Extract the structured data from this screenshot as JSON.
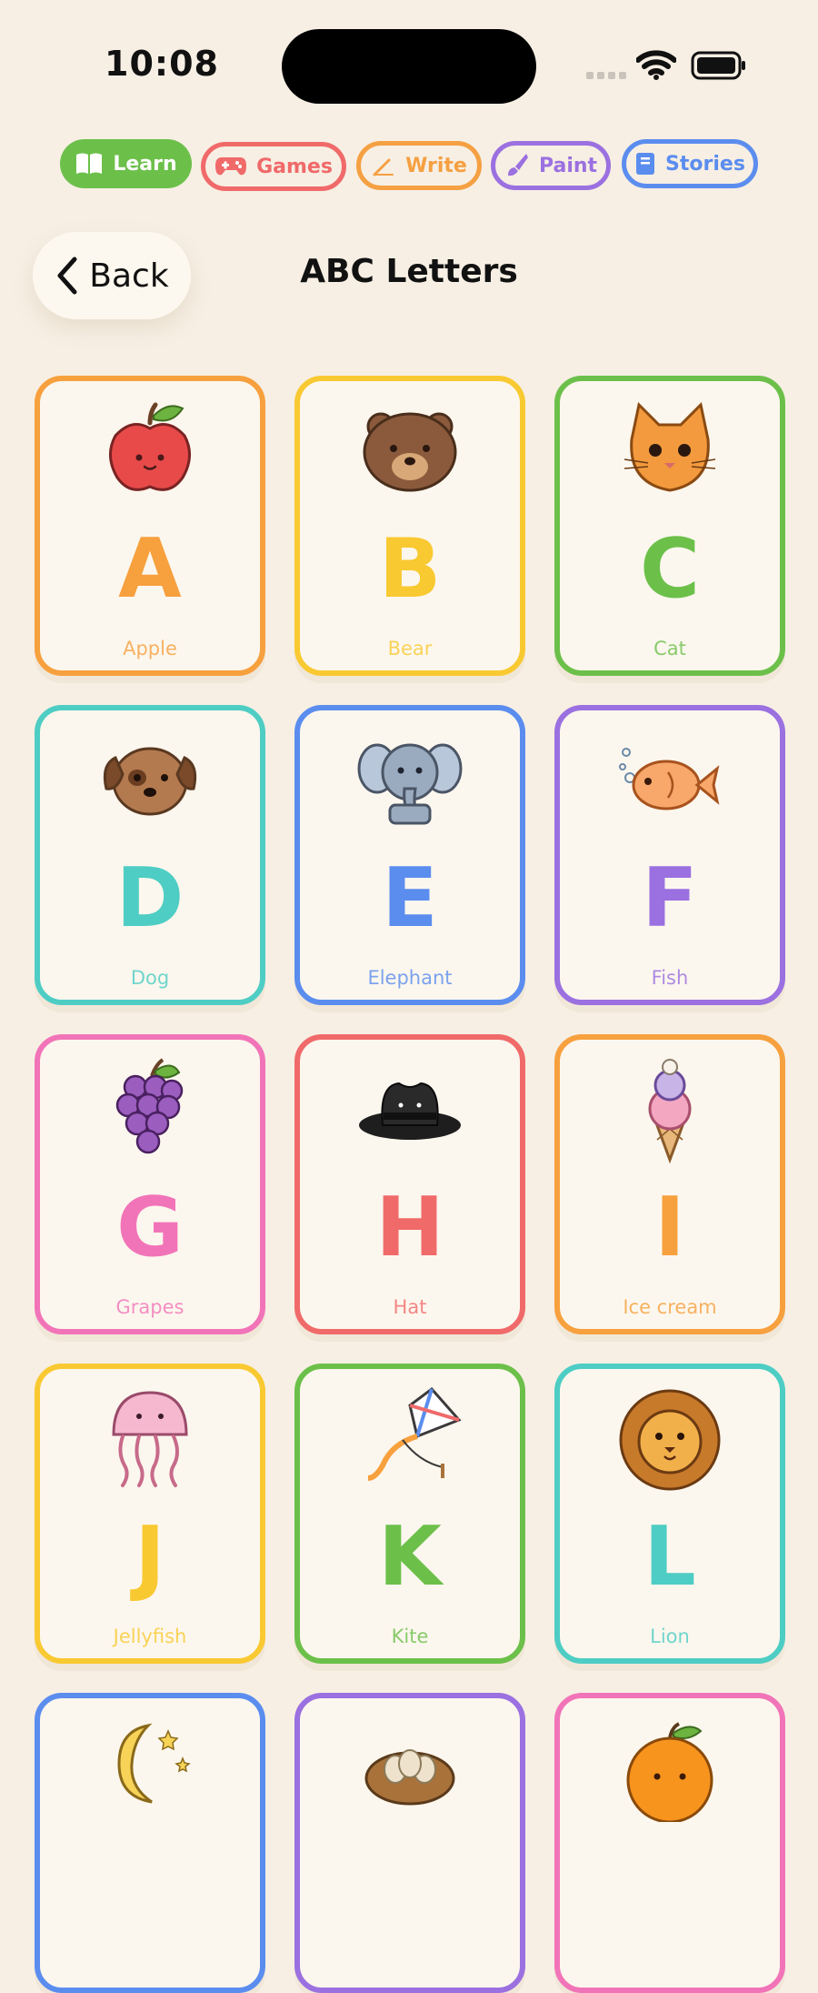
{
  "status_bar": {
    "time": "10:08"
  },
  "tabs": [
    {
      "label": "Learn",
      "icon": "book-icon",
      "color": "#6cc04a",
      "active": true
    },
    {
      "label": "Games",
      "icon": "gamepad-icon",
      "color": "#f06a6a",
      "active": false
    },
    {
      "label": "Write",
      "icon": "pencil-icon",
      "color": "#f5a042",
      "active": false
    },
    {
      "label": "Paint",
      "icon": "brush-icon",
      "color": "#9b70e0",
      "active": false
    },
    {
      "label": "Stories",
      "icon": "book-closed-icon",
      "color": "#5b8def",
      "active": false
    }
  ],
  "header": {
    "back_label": "Back",
    "title": "ABC Letters"
  },
  "cards": [
    {
      "letter": "A",
      "word": "Apple",
      "icon": "apple-icon",
      "color": "#f7a03e"
    },
    {
      "letter": "B",
      "word": "Bear",
      "icon": "bear-icon",
      "color": "#f9c932"
    },
    {
      "letter": "C",
      "word": "Cat",
      "icon": "cat-icon",
      "color": "#6cc04a"
    },
    {
      "letter": "D",
      "word": "Dog",
      "icon": "dog-icon",
      "color": "#4ecdc4"
    },
    {
      "letter": "E",
      "word": "Elephant",
      "icon": "elephant-icon",
      "color": "#5b8def"
    },
    {
      "letter": "F",
      "word": "Fish",
      "icon": "fish-icon",
      "color": "#9b70e0"
    },
    {
      "letter": "G",
      "word": "Grapes",
      "icon": "grapes-icon",
      "color": "#f274b8"
    },
    {
      "letter": "H",
      "word": "Hat",
      "icon": "hat-icon",
      "color": "#f06a6a"
    },
    {
      "letter": "I",
      "word": "Ice cream",
      "icon": "ice-cream-icon",
      "color": "#f7a03e"
    },
    {
      "letter": "J",
      "word": "Jellyfish",
      "icon": "jellyfish-icon",
      "color": "#f9c932"
    },
    {
      "letter": "K",
      "word": "Kite",
      "icon": "kite-icon",
      "color": "#6cc04a"
    },
    {
      "letter": "L",
      "word": "Lion",
      "icon": "lion-icon",
      "color": "#4ecdc4"
    },
    {
      "letter": "",
      "word": "",
      "icon": "moon-icon",
      "color": "#5b8def"
    },
    {
      "letter": "",
      "word": "",
      "icon": "nest-icon",
      "color": "#9b70e0"
    },
    {
      "letter": "",
      "word": "",
      "icon": "orange-icon",
      "color": "#f274b8"
    }
  ]
}
